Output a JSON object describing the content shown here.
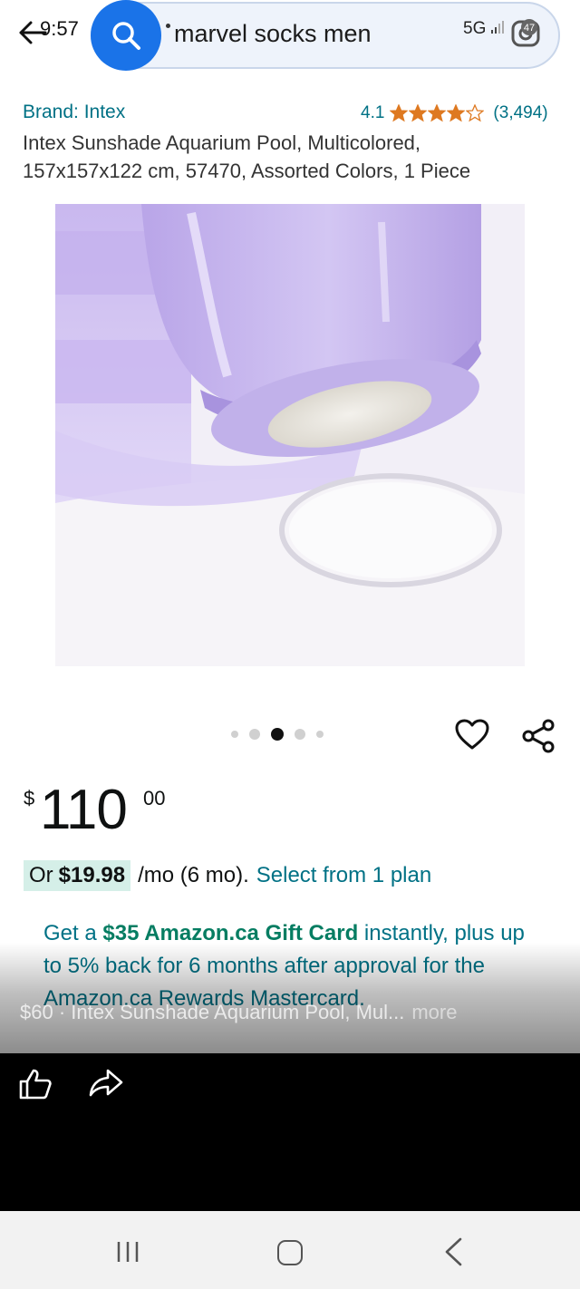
{
  "status_bar": {
    "time": "9:57",
    "network": "5G",
    "battery": "47"
  },
  "search": {
    "query": "marvel socks men"
  },
  "product": {
    "brand": "Brand: Intex",
    "rating": "4.1",
    "rating_value": 4.1,
    "rating_count": "(3,494)",
    "title": "Intex Sunshade Aquarium Pool, Multicolored, 157x157x122 cm, 57470, Assorted Colors, 1 Piece",
    "image_index": 3,
    "image_count": 5
  },
  "price": {
    "symbol": "$",
    "whole": "110",
    "fraction": "00"
  },
  "installment": {
    "prefix": "Or",
    "amount": "$19.98",
    "terms": "/mo (6 mo).",
    "link": "Select from 1 plan"
  },
  "promo": {
    "pre": "Get a",
    "gift": "$35 Amazon.ca Gift Card",
    "post": "instantly, plus up to 5% back for 6 months after approval for the Amazon.ca Rewards Mastercard."
  },
  "overlay": {
    "caption": "$60 · Intex Sunshade Aquarium Pool, Mul...",
    "more": "more"
  },
  "colors": {
    "link": "#007185",
    "green": "#067d62",
    "search_accent": "#1a73e8",
    "star": "#de7921",
    "installment_bg": "#d5efe8"
  },
  "icons": {
    "back": "arrow-left-icon",
    "search": "search-icon",
    "lens": "camera-lens-icon",
    "wishlist": "heart-icon",
    "share": "share-icon",
    "like": "thumbs-up-icon",
    "forward": "forward-arrow-icon"
  }
}
